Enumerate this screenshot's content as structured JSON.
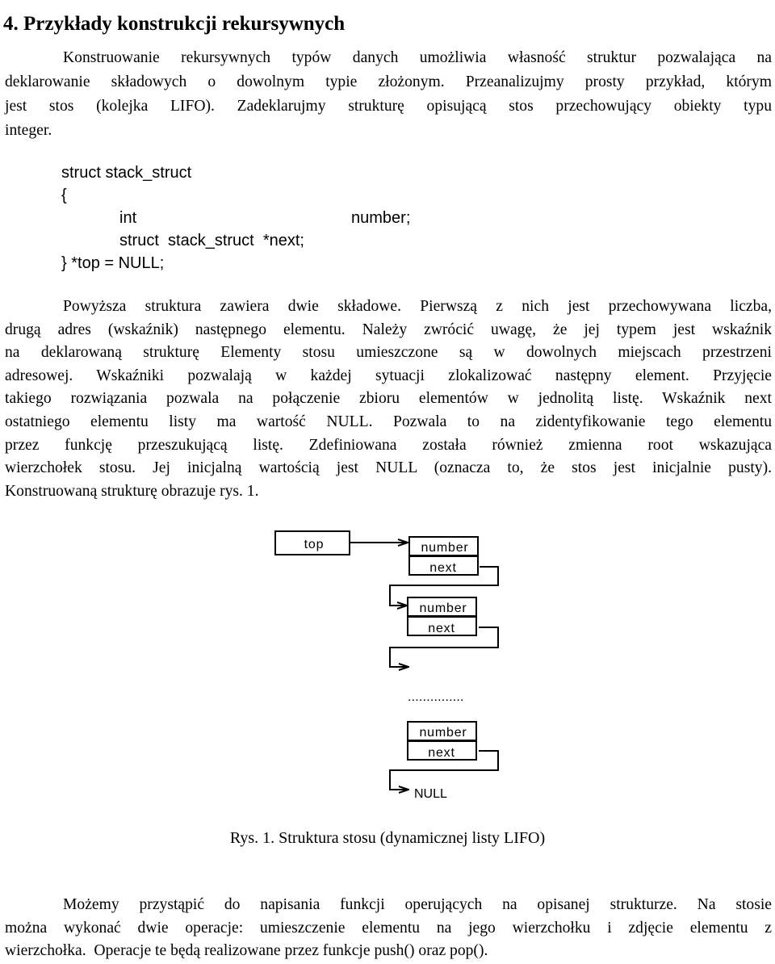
{
  "heading": "4. Przykłady konstrukcji rekursywnych",
  "paragraph1": {
    "lines": [
      "Konstruowanie rekursywnych typów danych umożliwia własność struktur pozwalająca na",
      "deklarowanie składowych o dowolnym typie złożonym. Przeanalizujmy prosty przykład, którym",
      "jest stos (kolejka LIFO). Zadeklarujmy strukturę opisującą stos przechowujący obiekty typu",
      "integer."
    ]
  },
  "code": {
    "line1": "struct stack_struct",
    "line2": "{",
    "line3_type": "int",
    "line3_name": "number;",
    "line4": "struct  stack_struct  *next;",
    "line5": "} *top = NULL;"
  },
  "paragraph2": {
    "lines": [
      "Powyższa struktura zawiera dwie składowe. Pierwszą z nich jest przechowywana liczba,",
      "drugą adres (wskaźnik) następnego elementu. Należy zwrócić uwagę, że jej typem jest wskaźnik",
      "na deklarowaną strukturę Elementy stosu umieszczone są w dowolnych miejscach przestrzeni",
      "adresowej. Wskaźniki pozwalają w każdej sytuacji zlokalizować następny element. Przyjęcie",
      "takiego rozwiązania pozwala na połączenie zbioru elementów w jednolitą listę. Wskaźnik next",
      "ostatniego elementu listy ma wartość NULL. Pozwala to na zidentyfikowanie tego elementu",
      "przez funkcję przeszukującą listę. Zdefiniowana została również zmienna root wskazująca",
      "wierzchołek stosu. Jej inicjalną wartością jest NULL (oznacza to, że stos jest inicjalnie pusty).",
      "Konstruowaną strukturę obrazuje rys. 1."
    ]
  },
  "diagram": {
    "top_label": "top",
    "nodes": [
      {
        "field1": "number",
        "field2": "next"
      },
      {
        "field1": "number",
        "field2": "next"
      },
      {
        "field1": "number",
        "field2": "next"
      }
    ],
    "ellipsis": "...............",
    "terminator": "NULL"
  },
  "caption": "Rys. 1. Struktura stosu (dynamicznej listy LIFO)",
  "paragraph3": {
    "lines": [
      "Możemy przystąpić do napisania funkcji operujących na opisanej strukturze. Na stosie",
      "można wykonać dwie operacje: umieszczenie elementu na jego wierzchołku i zdjęcie elementu z",
      "wierzchołka.  Operacje te będą realizowane przez funkcje push() oraz pop()."
    ]
  }
}
